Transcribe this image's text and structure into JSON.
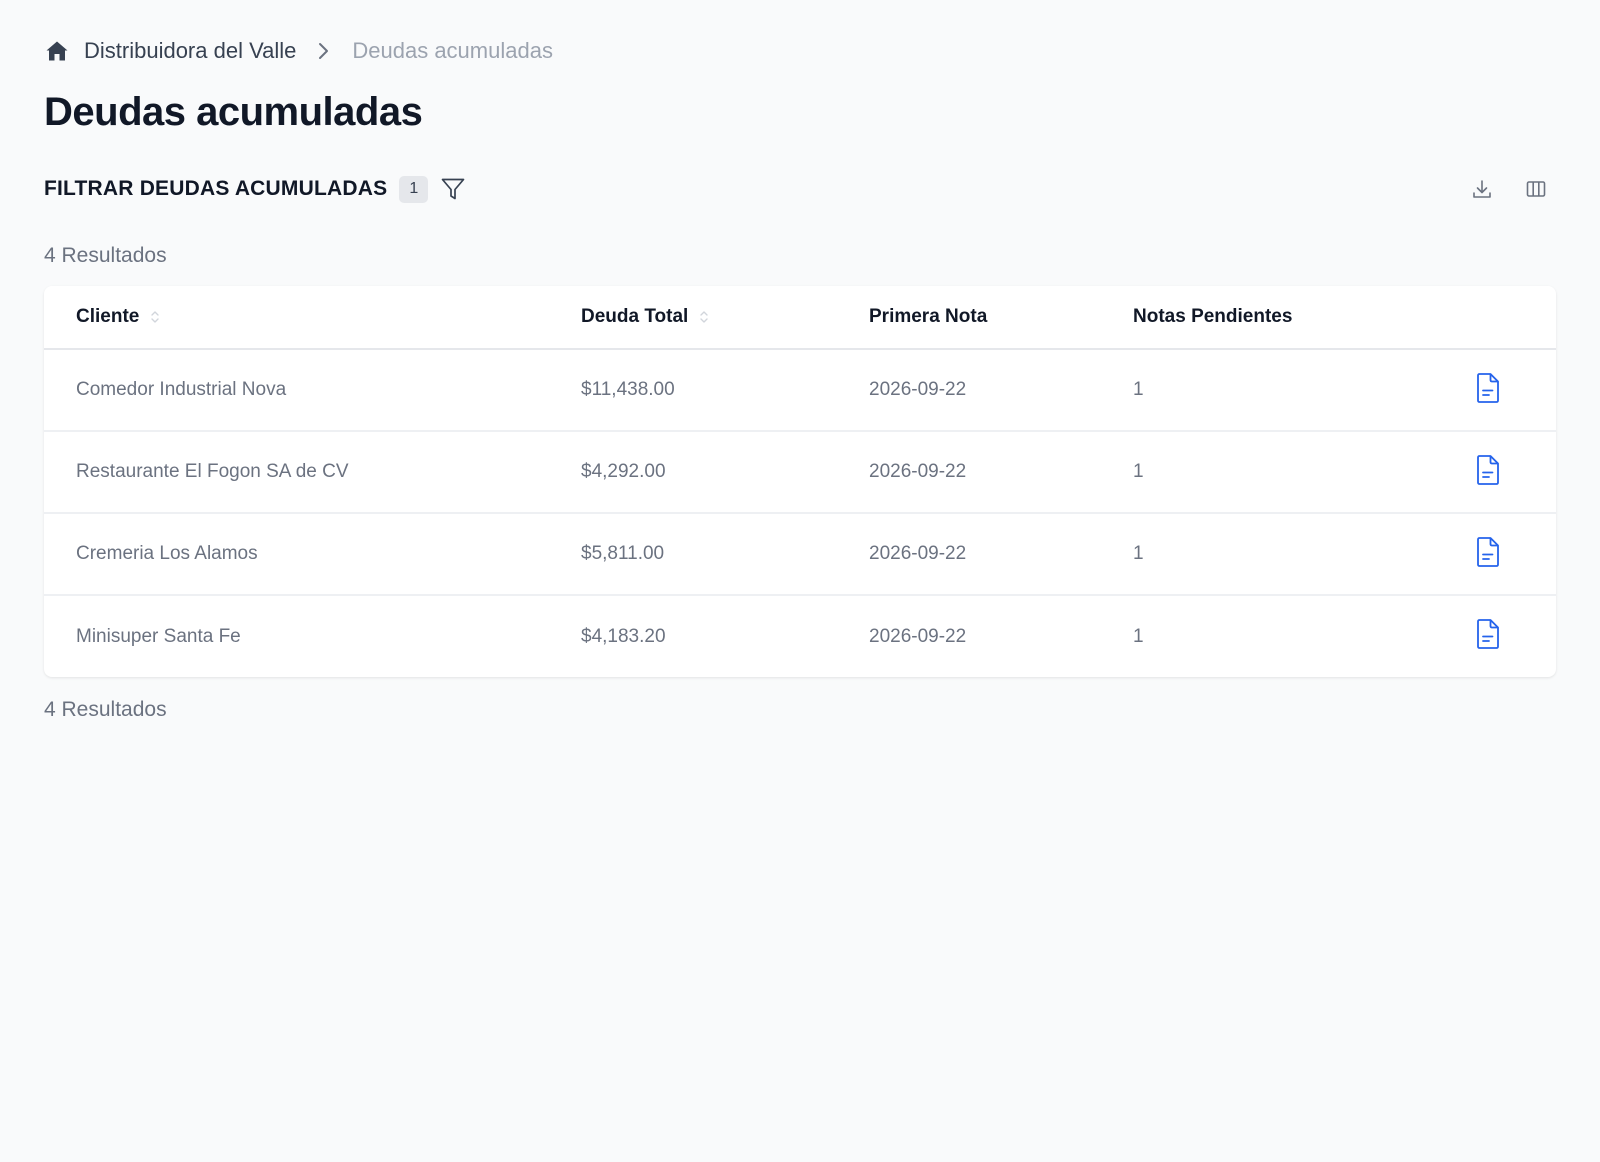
{
  "breadcrumb": {
    "home_icon": "home-icon",
    "company": "Distribuidora del Valle",
    "separator_icon": "chevron-right-icon",
    "current": "Deudas acumuladas"
  },
  "page": {
    "title": "Deudas acumuladas"
  },
  "filter": {
    "title": "FILTRAR DEUDAS ACUMULADAS",
    "active_count": "1",
    "filter_icon": "funnel-icon"
  },
  "toolbar": {
    "download_icon": "download-icon",
    "columns_icon": "columns-icon"
  },
  "results": {
    "top_label": "4 Resultados",
    "bottom_label": "4 Resultados"
  },
  "table": {
    "headers": {
      "cliente": "Cliente",
      "deuda_total": "Deuda Total",
      "primera_nota": "Primera Nota",
      "notas_pendientes": "Notas Pendientes"
    },
    "sortable": [
      "cliente",
      "deuda_total"
    ],
    "rows": [
      {
        "cliente": "Comedor Industrial Nova",
        "deuda_total": "$11,438.00",
        "primera_nota": "2026-09-22",
        "notas_pendientes": "1",
        "action_icon": "document-icon"
      },
      {
        "cliente": "Restaurante El Fogon SA de CV",
        "deuda_total": "$4,292.00",
        "primera_nota": "2026-09-22",
        "notas_pendientes": "1",
        "action_icon": "document-icon"
      },
      {
        "cliente": "Cremeria Los Alamos",
        "deuda_total": "$5,811.00",
        "primera_nota": "2026-09-22",
        "notas_pendientes": "1",
        "action_icon": "document-icon"
      },
      {
        "cliente": "Minisuper Santa Fe",
        "deuda_total": "$4,183.20",
        "primera_nota": "2026-09-22",
        "notas_pendientes": "1",
        "action_icon": "document-icon"
      }
    ]
  },
  "colors": {
    "background": "#f9fafb",
    "accent_blue": "#2563eb",
    "text_primary": "#111827",
    "text_muted": "#6b7280"
  }
}
